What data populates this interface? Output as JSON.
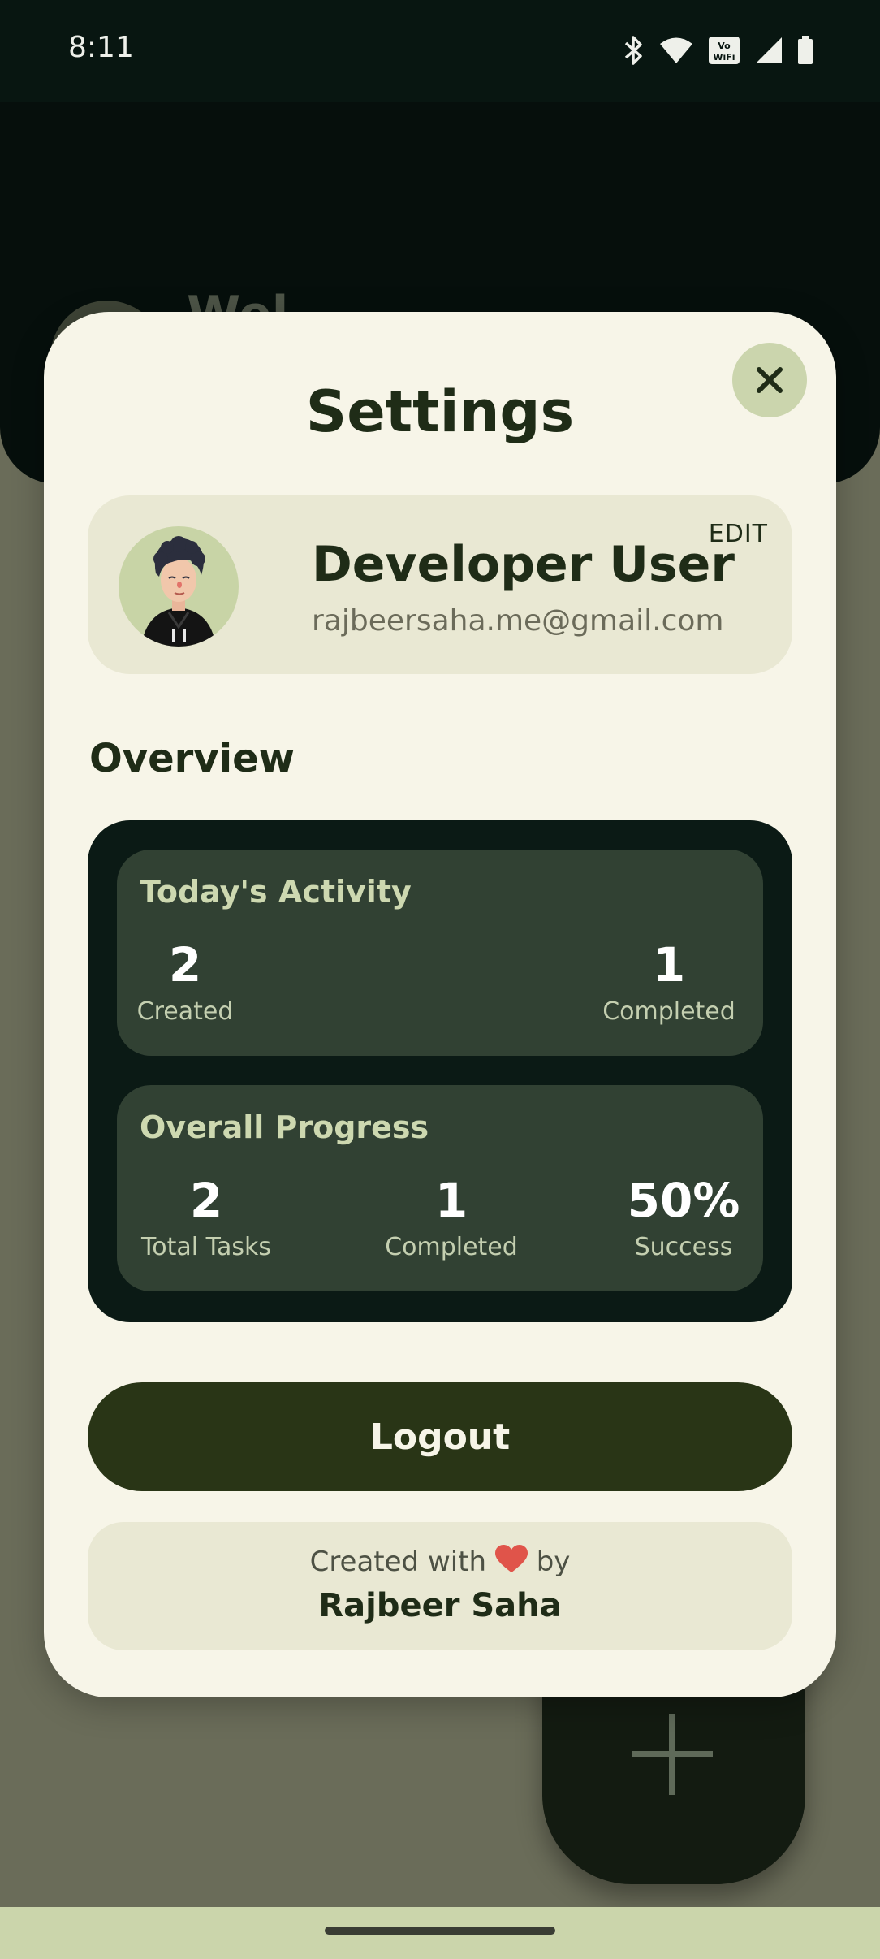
{
  "status_bar": {
    "time": "8:11",
    "icons": [
      "bluetooth-icon",
      "wifi-icon",
      "vowifi-icon",
      "signal-icon",
      "battery-icon"
    ]
  },
  "background": {
    "title_peek": "Wel",
    "fab_icon": "plus-icon"
  },
  "dialog": {
    "title": "Settings",
    "close_icon": "close-icon",
    "profile": {
      "name": "Developer User",
      "email": "rajbeersaha.me@gmail.com",
      "edit_label": "EDIT"
    },
    "overview": {
      "title": "Overview",
      "today": {
        "title": "Today's Activity",
        "stats": [
          {
            "value": "2",
            "label": "Created"
          },
          {
            "value": "1",
            "label": "Completed"
          }
        ]
      },
      "overall": {
        "title": "Overall Progress",
        "stats": [
          {
            "value": "2",
            "label": "Total Tasks"
          },
          {
            "value": "1",
            "label": "Completed"
          },
          {
            "value": "50%",
            "label": "Success"
          }
        ]
      }
    },
    "logout_label": "Logout",
    "credit": {
      "line_prefix": "Created with",
      "line_suffix": "by",
      "heart_icon": "heart-icon",
      "author": "Rajbeer Saha"
    }
  },
  "colors": {
    "surface": "#f7f5e8",
    "accent_dark": "#293516",
    "overview_bg": "#0b1a15",
    "stat_card": "#314133",
    "chip": "#cbd5ad"
  }
}
